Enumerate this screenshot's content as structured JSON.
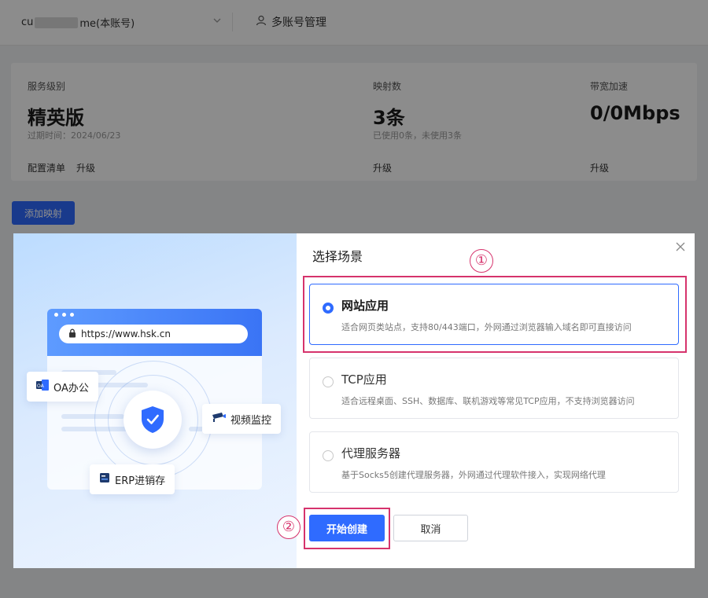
{
  "topbar": {
    "account_prefix": "cu",
    "account_suffix": "me(本账号)",
    "multi_account": "多账号管理"
  },
  "stats": {
    "service_level": {
      "label": "服务级别",
      "value": "精英版",
      "sub": "过期时间：2024/06/23",
      "links": [
        "配置清单",
        "升级"
      ]
    },
    "mappings": {
      "label": "映射数",
      "value": "3条",
      "sub": "已使用0条，未使用3条",
      "links": [
        "升级"
      ]
    },
    "bandwidth": {
      "label": "带宽加速",
      "value": "0/0Mbps",
      "links": [
        "升级"
      ]
    }
  },
  "add_mapping": "添加映射",
  "modal": {
    "title": "选择场景",
    "hero": {
      "url": "https://www.hsk.cn",
      "tags": [
        "OA办公",
        "视频监控",
        "ERP进销存"
      ]
    },
    "options": [
      {
        "title": "网站应用",
        "desc": "适合网页类站点，支持80/443端口，外网通过浏览器输入域名即可直接访问",
        "selected": true
      },
      {
        "title": "TCP应用",
        "desc": "适合远程桌面、SSH、数据库、联机游戏等常见TCP应用，不支持浏览器访问",
        "selected": false
      },
      {
        "title": "代理服务器",
        "desc": "基于Socks5创建代理服务器，外网通过代理软件接入，实现网络代理",
        "selected": false
      }
    ],
    "confirm": "开始创建",
    "cancel": "取消",
    "annotations": [
      "①",
      "②"
    ]
  },
  "colors": {
    "primary": "#2f6bff",
    "annotation": "#d6336c"
  },
  "icons": [
    "chevron-down-icon",
    "user-icon",
    "close-icon",
    "lock-icon",
    "shield-check-icon",
    "document-icon",
    "camera-icon",
    "server-icon"
  ]
}
